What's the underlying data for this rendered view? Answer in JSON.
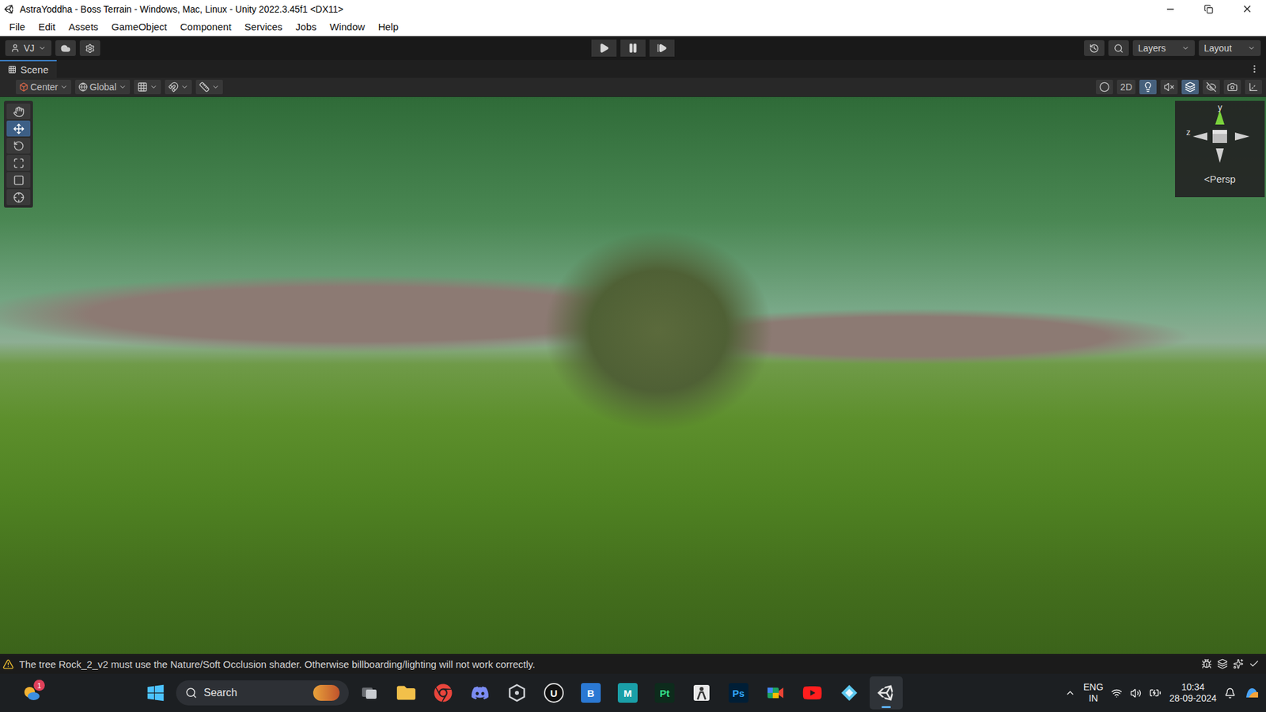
{
  "window": {
    "title": "AstraYoddha - Boss Terrain - Windows, Mac, Linux - Unity 2022.3.45f1 <DX11>"
  },
  "menu": [
    "File",
    "Edit",
    "Assets",
    "GameObject",
    "Component",
    "Services",
    "Jobs",
    "Window",
    "Help"
  ],
  "toolbar": {
    "account": "VJ",
    "play_controls": [
      {
        "kind": "play",
        "selected": false
      },
      {
        "kind": "pause",
        "selected": false
      },
      {
        "kind": "step",
        "selected": false
      }
    ],
    "layers": "Layers",
    "layout": "Layout"
  },
  "scene_tab": {
    "label": "Scene",
    "selected": true
  },
  "scene_toolbar": {
    "pivot": "Center",
    "space": "Global",
    "snap": [
      {
        "kind": "grid"
      },
      {
        "kind": "snap"
      },
      {
        "kind": "increment"
      }
    ],
    "mode_2d": {
      "label": "2D",
      "selected": false
    },
    "toggles": [
      {
        "kind": "shading",
        "selected": false
      },
      {
        "kind": "lighting",
        "selected": true
      },
      {
        "kind": "audio",
        "selected": false
      },
      {
        "kind": "effects",
        "selected": true
      },
      {
        "kind": "visibility",
        "selected": false
      },
      {
        "kind": "camera",
        "selected": false
      },
      {
        "kind": "gizmos",
        "selected": false
      }
    ]
  },
  "tools": [
    {
      "kind": "hand",
      "selected": false
    },
    {
      "kind": "move",
      "selected": true
    },
    {
      "kind": "rotate",
      "selected": false
    },
    {
      "kind": "scale",
      "selected": false
    },
    {
      "kind": "rect",
      "selected": false
    },
    {
      "kind": "transform",
      "selected": false
    }
  ],
  "gizmo": {
    "y": "y",
    "z": "z",
    "projection": "<Persp"
  },
  "status_bar": {
    "severity": "warning",
    "message": "The tree Rock_2_v2 must use the Nature/Soft Occlusion shader. Otherwise billboarding/lighting will not work correctly."
  },
  "taskbar": {
    "widget_badge": "1",
    "search": "Search",
    "apps": [
      {
        "kind": "taskview",
        "active": false
      },
      {
        "kind": "explorer",
        "active": false
      },
      {
        "kind": "chrome",
        "active": false
      },
      {
        "kind": "discord",
        "active": false
      },
      {
        "kind": "unityhub",
        "active": false
      },
      {
        "kind": "round",
        "glyph": "U",
        "color": "#111111",
        "text_color": "#ffffff",
        "active": false
      },
      {
        "kind": "tile",
        "glyph": "B",
        "color": "#2b79d4",
        "text_color": "#ffffff",
        "active": false
      },
      {
        "kind": "tile",
        "glyph": "M",
        "color": "#1a9fa8",
        "text_color": "#ffffff",
        "active": false
      },
      {
        "kind": "tile",
        "glyph": "Pt",
        "color": "#0d2b1c",
        "text_color": "#35e08a",
        "active": false
      },
      {
        "kind": "figure",
        "active": false
      },
      {
        "kind": "tile",
        "glyph": "Ps",
        "color": "#001e36",
        "text_color": "#31a8ff",
        "active": false
      },
      {
        "kind": "meet",
        "active": false
      },
      {
        "kind": "youtube",
        "active": false
      },
      {
        "kind": "diamond",
        "active": false
      },
      {
        "kind": "unity",
        "active": true
      }
    ],
    "language": "ENG",
    "region": "IN",
    "time": "10:34",
    "date": "28-09-2024"
  }
}
